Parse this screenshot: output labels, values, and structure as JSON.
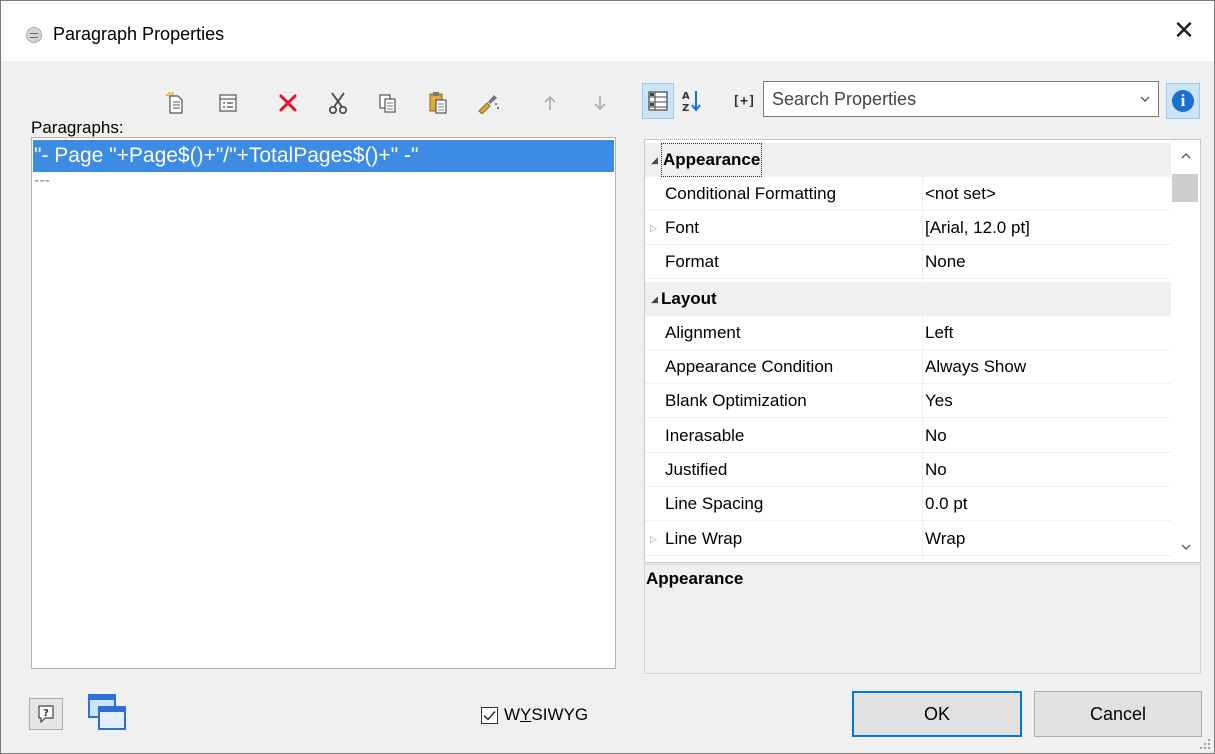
{
  "window": {
    "title": "Paragraph Properties"
  },
  "paragraphs": {
    "label": "Paragraphs:",
    "items": [
      "\"- Page \"+Page$()+\"/\"+TotalPages$()+\" -\"",
      "---"
    ]
  },
  "toolbar": {
    "icons": [
      "new-paragraph-icon",
      "properties-list-icon",
      "delete-icon",
      "cut-icon",
      "copy-icon",
      "paste-icon",
      "format-brush-icon",
      "move-up-icon",
      "move-down-icon"
    ]
  },
  "properties_toolbar": {
    "expand_label": "[+]",
    "search_placeholder": "Search Properties"
  },
  "properties": {
    "categories": [
      {
        "name": "Appearance",
        "rows": [
          {
            "name": "Conditional Formatting",
            "value": "<not set>"
          },
          {
            "name": "Font",
            "value": "[Arial, 12.0 pt]",
            "expandable": true
          },
          {
            "name": "Format",
            "value": "None"
          }
        ]
      },
      {
        "name": "Layout",
        "rows": [
          {
            "name": "Alignment",
            "value": "Left"
          },
          {
            "name": "Appearance Condition",
            "value": "Always Show"
          },
          {
            "name": "Blank Optimization",
            "value": "Yes"
          },
          {
            "name": "Inerasable",
            "value": "No"
          },
          {
            "name": "Justified",
            "value": "No"
          },
          {
            "name": "Line Spacing",
            "value": "0.0 pt"
          },
          {
            "name": "Line Wrap",
            "value": "Wrap",
            "expandable": true
          }
        ]
      }
    ]
  },
  "description": {
    "title": "Appearance"
  },
  "footer": {
    "wysiwyg_label_before": "W",
    "wysiwyg_label_underlined": "Y",
    "wysiwyg_label_after": "SIWYG",
    "wysiwyg_checked": true,
    "ok_label": "OK",
    "cancel_label": "Cancel"
  },
  "colors": {
    "selection": "#3d8ce3",
    "accent": "#0078d7",
    "delete_red": "#e81123"
  }
}
